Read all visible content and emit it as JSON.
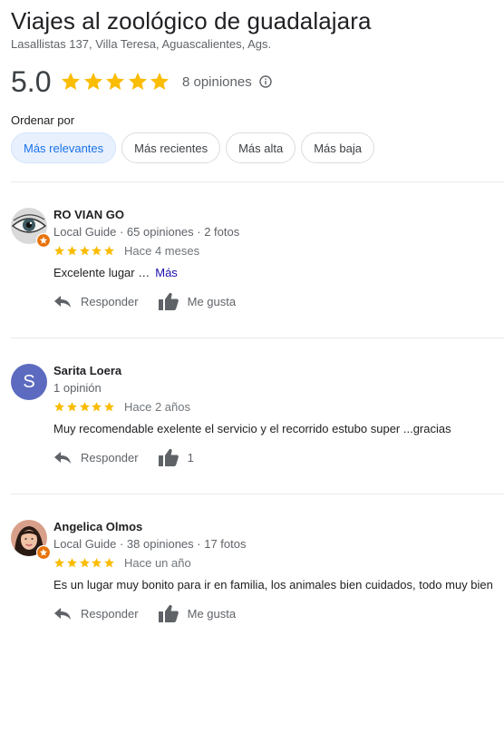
{
  "place": {
    "title": "Viajes al zoológico de guadalajara",
    "address": "Lasallistas 137, Villa Teresa, Aguascalientes, Ags."
  },
  "summary": {
    "rating": "5.0",
    "stars": 5,
    "count_label": "8 opiniones"
  },
  "sort": {
    "label": "Ordenar por",
    "options": [
      "Más relevantes",
      "Más recientes",
      "Más alta",
      "Más baja"
    ],
    "selected_index": 0
  },
  "colors": {
    "star": "#fbbc04",
    "accent": "#1a73e8",
    "link": "#1a0dab",
    "guide_badge": "#e8710a",
    "letter_avatar": "#5c6bc0"
  },
  "actions": {
    "reply_label": "Responder"
  },
  "reviews": [
    {
      "name": "RO VIAN GO",
      "meta": "Local Guide · 65 opiniones · 2 fotos",
      "stars": 5,
      "time": "Hace 4 meses",
      "text": "Excelente lugar …",
      "more_label": "Más",
      "like_label": "Me gusta",
      "avatar_icon": "eye-photo",
      "local_guide": true
    },
    {
      "name": "Sarita Loera",
      "meta": "1 opinión",
      "stars": 5,
      "time": "Hace 2 años",
      "text": "Muy recomendable exelente el servicio y el recorrido estubo super ...gracias",
      "like_label": "1",
      "avatar_letter": "S",
      "local_guide": false
    },
    {
      "name": "Angelica Olmos",
      "meta": "Local Guide · 38 opiniones · 17 fotos",
      "stars": 5,
      "time": "Hace un año",
      "text": "Es un lugar muy bonito para ir en familia, los animales bien cuidados, todo muy bien",
      "like_label": "Me gusta",
      "avatar_icon": "person-photo",
      "local_guide": true
    }
  ]
}
